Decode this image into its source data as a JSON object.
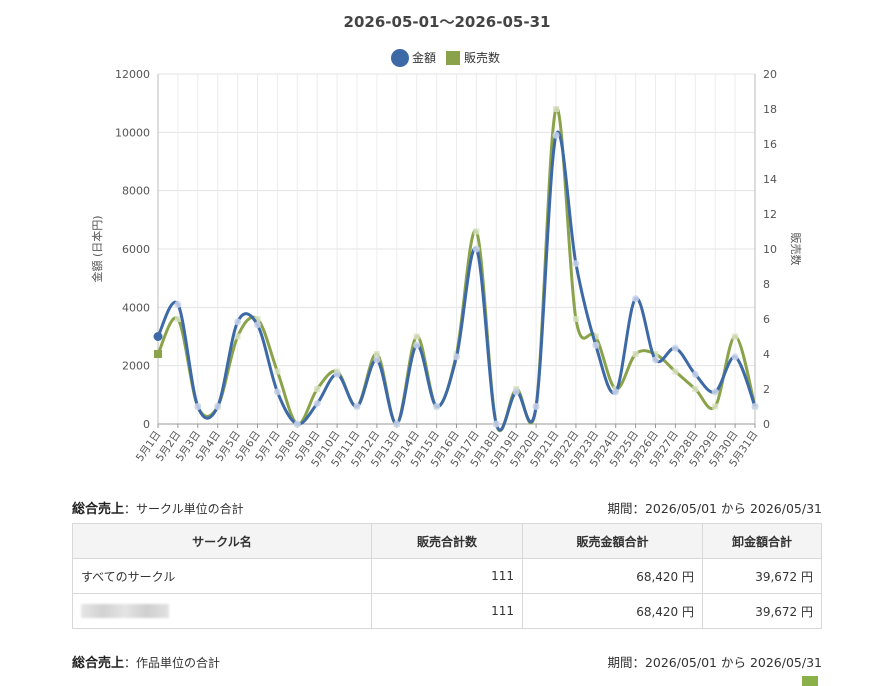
{
  "chart_data": {
    "type": "line",
    "title": "2026-05-01〜2026-05-31",
    "categories": [
      "5月1日",
      "5月2日",
      "5月3日",
      "5月4日",
      "5月5日",
      "5月6日",
      "5月7日",
      "5月8日",
      "5月9日",
      "5月10日",
      "5月11日",
      "5月12日",
      "5月13日",
      "5月14日",
      "5月15日",
      "5月16日",
      "5月17日",
      "5月18日",
      "5月19日",
      "5月20日",
      "5月21日",
      "5月22日",
      "5月23日",
      "5月24日",
      "5月25日",
      "5月26日",
      "5月27日",
      "5月28日",
      "5月29日",
      "5月30日",
      "5月31日"
    ],
    "series": [
      {
        "name": "金額",
        "axis": "left",
        "color": "#3d6aa6",
        "values": [
          3000,
          4100,
          600,
          600,
          3500,
          3400,
          1100,
          0,
          700,
          1700,
          600,
          2200,
          0,
          2700,
          600,
          2300,
          6000,
          0,
          1100,
          600,
          9900,
          5500,
          2700,
          1100,
          4300,
          2200,
          2600,
          1700,
          1100,
          2300,
          600
        ]
      },
      {
        "name": "販売数",
        "axis": "right",
        "color": "#8aa34a",
        "values": [
          4,
          6,
          1,
          1,
          5,
          6,
          3,
          0,
          2,
          3,
          1,
          4,
          0,
          5,
          1,
          4,
          11,
          0,
          2,
          1,
          18,
          6,
          5,
          2,
          4,
          4,
          3,
          2,
          1,
          5,
          1
        ]
      }
    ],
    "ylabel": "金額 (日本円)",
    "y2label": "販売数",
    "ylim": [
      0,
      12000
    ],
    "y2lim": [
      0,
      20
    ],
    "yticks": [
      0,
      2000,
      4000,
      6000,
      8000,
      10000,
      12000
    ],
    "y2ticks": [
      0,
      2,
      4,
      6,
      8,
      10,
      12,
      14,
      16,
      18,
      20
    ],
    "grid": true,
    "legend": "top-center"
  },
  "section1": {
    "title": "総合売上",
    "subtitle": "：サークル単位の合計",
    "period": "期間：2026/05/01 から 2026/05/31"
  },
  "table": {
    "headers": [
      "サークル名",
      "販売合計数",
      "販売金額合計",
      "卸金額合計"
    ],
    "rows": [
      {
        "name": "すべてのサークル",
        "count": "111",
        "sales": "68,420 円",
        "wholesale": "39,672 円"
      },
      {
        "name": "",
        "count": "111",
        "sales": "68,420 円",
        "wholesale": "39,672 円"
      }
    ]
  },
  "section2": {
    "title": "総合売上",
    "subtitle": "：作品単位の合計",
    "period": "期間：2026/05/01 から 2026/05/31"
  }
}
